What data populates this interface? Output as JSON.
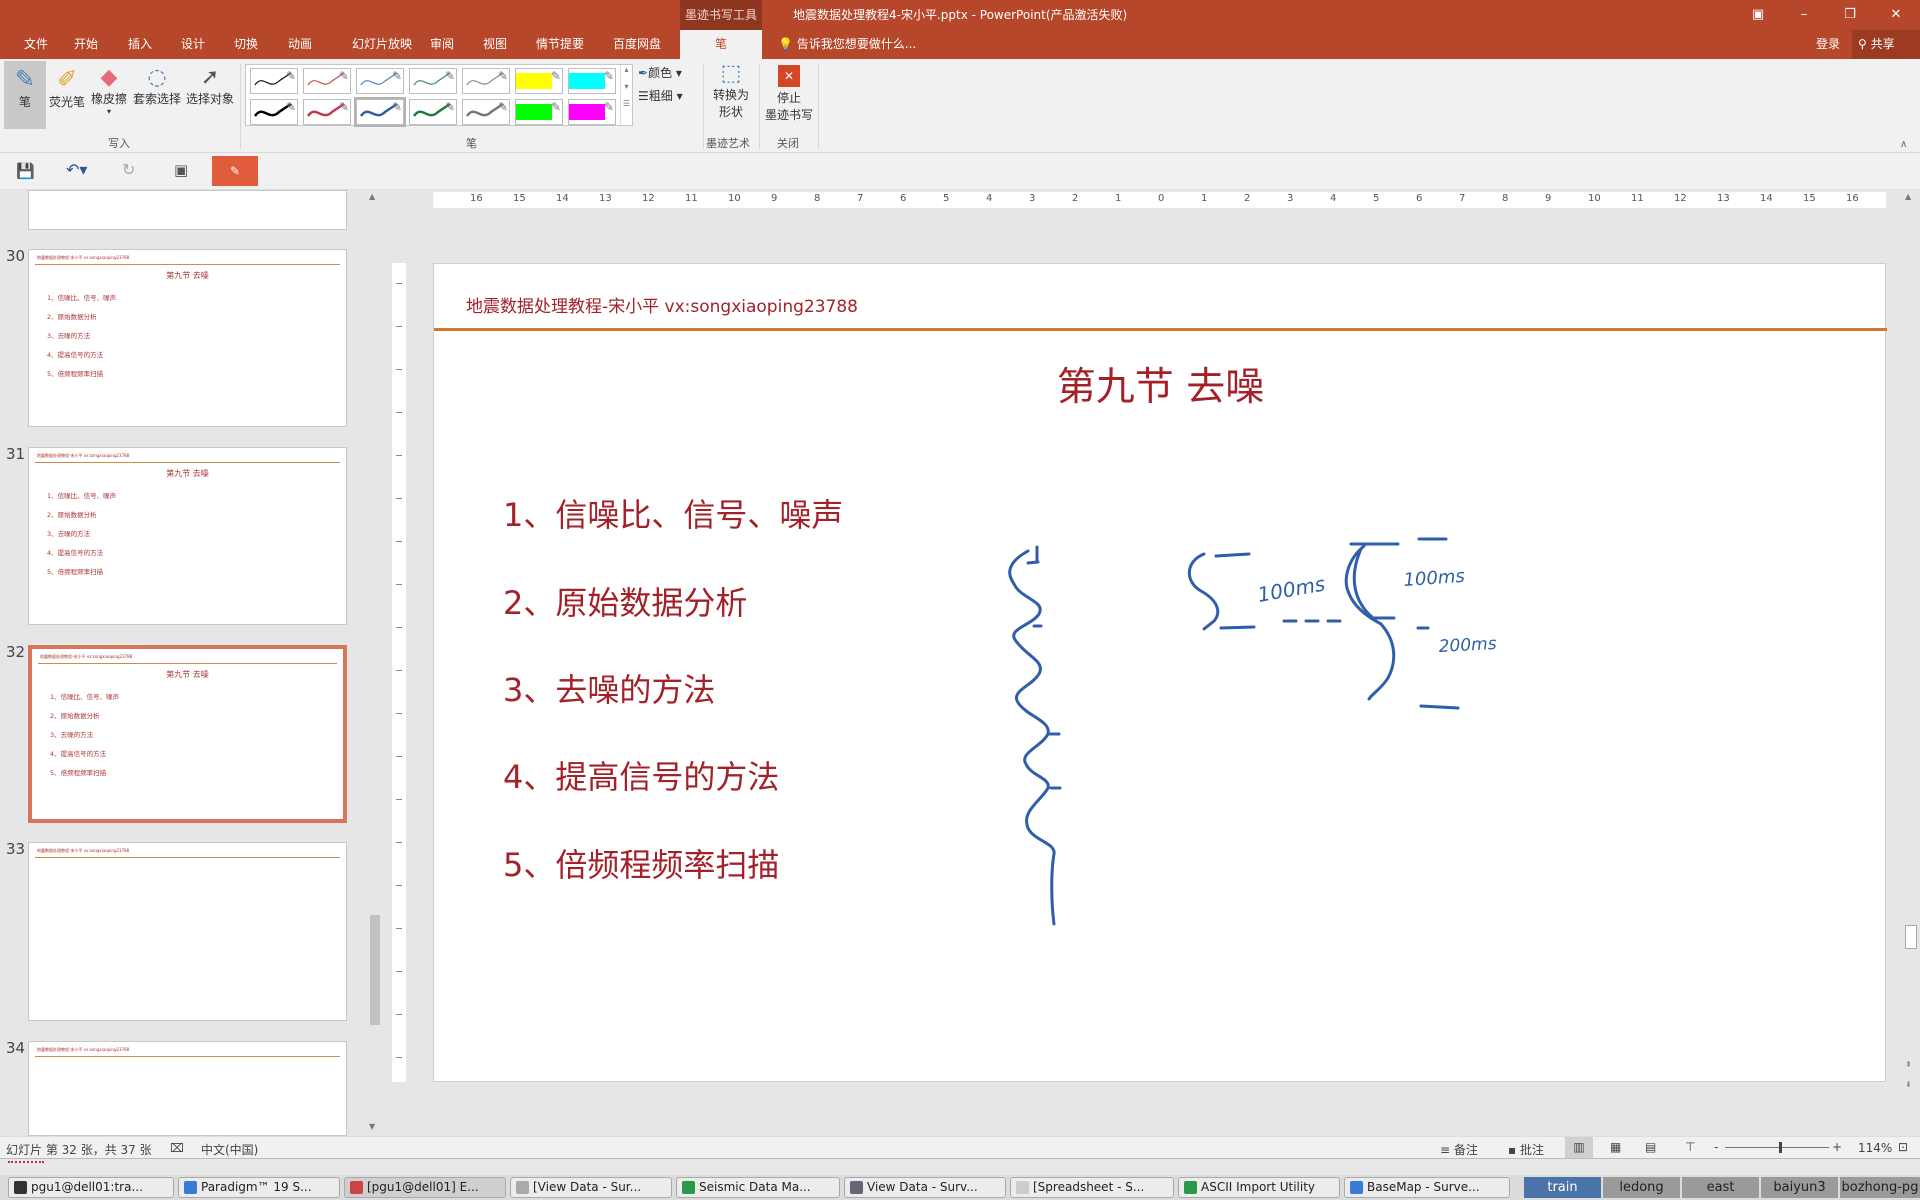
{
  "titlebar": {
    "context_tab_group": "墨迹书写工具",
    "document_title": "地震数据处理教程4-宋小平.pptx - PowerPoint(产品激活失败)",
    "controls": [
      "ribbon-display-icon",
      "minimize-icon",
      "restore-icon",
      "close-icon"
    ]
  },
  "tabs": [
    {
      "label": "文件"
    },
    {
      "label": "开始"
    },
    {
      "label": "插入"
    },
    {
      "label": "设计"
    },
    {
      "label": "切换"
    },
    {
      "label": "动画"
    },
    {
      "label": "幻灯片放映"
    },
    {
      "label": "审阅"
    },
    {
      "label": "视图"
    },
    {
      "label": "情节提要"
    },
    {
      "label": "百度网盘"
    },
    {
      "label": "笔",
      "active": true
    }
  ],
  "tellme": "告诉我您想要做什么...",
  "account": {
    "login": "登录",
    "share": "共享"
  },
  "ribbon": {
    "write_group": {
      "label": "写入",
      "buttons": [
        "笔",
        "荧光笔",
        "橡皮擦",
        "套索选择",
        "选择对象"
      ]
    },
    "pens_group": {
      "label": "笔",
      "color": "颜色",
      "thickness": "粗细",
      "swatches": [
        {
          "color": "#111111",
          "kind": "pen"
        },
        {
          "color": "#c0504d",
          "kind": "pen"
        },
        {
          "color": "#4f81bd",
          "kind": "pen"
        },
        {
          "color": "#3c8a5c",
          "kind": "pen"
        },
        {
          "color": "#8a8a8a",
          "kind": "pen"
        },
        {
          "color": "#ffff00",
          "kind": "highlighter"
        },
        {
          "color": "#00ffff",
          "kind": "highlighter"
        },
        {
          "color": "#000000",
          "kind": "thick-pen"
        },
        {
          "color": "#c0394d",
          "kind": "thick-pen"
        },
        {
          "color": "#2f5fa0",
          "kind": "thick-pen",
          "selected": true
        },
        {
          "color": "#1e7a3c",
          "kind": "thick-pen"
        },
        {
          "color": "#777777",
          "kind": "thick-pen"
        },
        {
          "color": "#00ff00",
          "kind": "highlighter"
        },
        {
          "color": "#ff00ff",
          "kind": "highlighter"
        }
      ]
    },
    "ink_art_group": {
      "label": "墨迹艺术",
      "convert_line1": "转换为",
      "convert_line2": "形状"
    },
    "close_group": {
      "label": "关闭",
      "stop_line1": "停止",
      "stop_line2": "墨迹书写"
    }
  },
  "thumbnails": [
    {
      "number": "30",
      "title": "第九节 去噪"
    },
    {
      "number": "31",
      "title": "第九节 去噪"
    },
    {
      "number": "32",
      "title": "第九节 去噪",
      "selected": true
    },
    {
      "number": "33"
    },
    {
      "number": "34"
    }
  ],
  "ruler_labels": [
    "16",
    "15",
    "14",
    "13",
    "12",
    "11",
    "10",
    "9",
    "8",
    "7",
    "6",
    "5",
    "4",
    "3",
    "2",
    "1",
    "0",
    "1",
    "2",
    "3",
    "4",
    "5",
    "6",
    "7",
    "8",
    "9",
    "10",
    "11",
    "12",
    "13",
    "14",
    "15",
    "16"
  ],
  "slide": {
    "header": "地震数据处理教程-宋小平 vx:songxiaoping23788",
    "title": "第九节 去噪",
    "items": [
      "1、信噪比、信号、噪声",
      "2、原始数据分析",
      "3、去噪的方法",
      "4、提高信号的方法",
      "5、倍频程频率扫描"
    ],
    "ink_color": "#2f5fa8",
    "ink_labels": [
      "100ms",
      "100ms",
      "200ms"
    ]
  },
  "status": {
    "slide_info": "幻灯片 第 32 张，共 37 张",
    "language": "中文(中国)",
    "notes": "备注",
    "comments": "批注",
    "zoom": "114%",
    "zoom_level_percent": 114
  },
  "taskbar": {
    "tasks": [
      "pgu1@dell01:tra...",
      "Paradigm™ 19 S...",
      "[pgu1@dell01] E...",
      "[View Data - Sur...",
      "Seismic Data Ma...",
      "View Data - Surv...",
      "[Spreadsheet - S...",
      "ASCII Import Utility",
      "BaseMap - Surve..."
    ],
    "workspaces": [
      {
        "label": "train",
        "active": true
      },
      {
        "label": "ledong"
      },
      {
        "label": "east"
      },
      {
        "label": "baiyun3"
      },
      {
        "label": "bozhong-pg"
      }
    ]
  }
}
